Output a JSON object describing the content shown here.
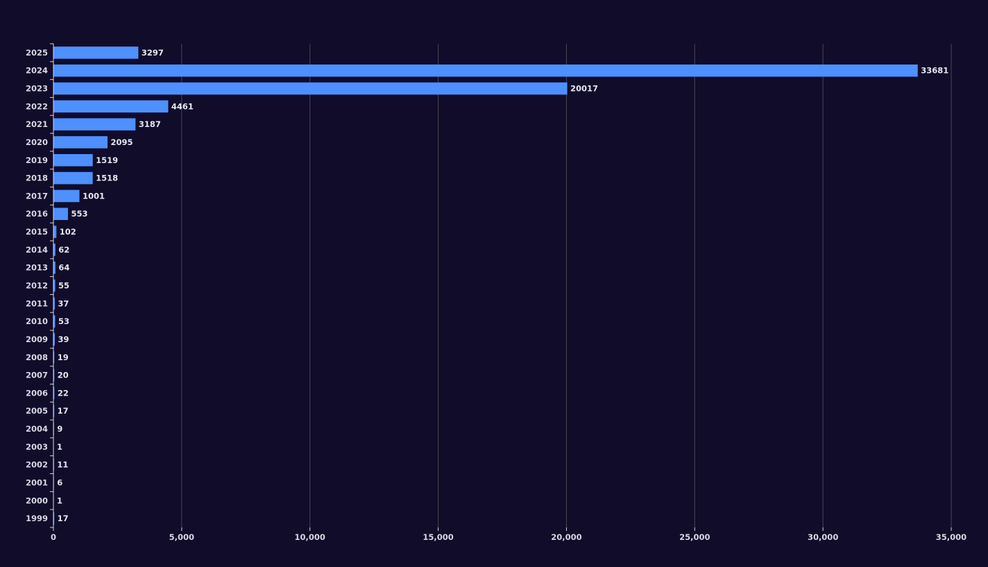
{
  "colors": {
    "background": "#100c2a",
    "bar": "#4d90fe",
    "grid": "#484753",
    "axis": "#d7d7e3",
    "text": "#d7d7e3"
  },
  "chart_data": {
    "type": "bar",
    "orientation": "horizontal",
    "title": "",
    "xlabel": "",
    "ylabel": "",
    "categories": [
      "2025",
      "2024",
      "2023",
      "2022",
      "2021",
      "2020",
      "2019",
      "2018",
      "2017",
      "2016",
      "2015",
      "2014",
      "2013",
      "2012",
      "2011",
      "2010",
      "2009",
      "2008",
      "2007",
      "2006",
      "2005",
      "2004",
      "2003",
      "2002",
      "2001",
      "2000",
      "1999"
    ],
    "values": [
      3297,
      33681,
      20017,
      4461,
      3187,
      2095,
      1519,
      1518,
      1001,
      553,
      102,
      62,
      64,
      55,
      37,
      53,
      39,
      19,
      20,
      22,
      17,
      9,
      1,
      11,
      6,
      1,
      17
    ],
    "xlim": [
      0,
      35000
    ],
    "xticks": [
      0,
      5000,
      10000,
      15000,
      20000,
      25000,
      30000,
      35000
    ],
    "xtick_labels": [
      "0",
      "5,000",
      "10,000",
      "15,000",
      "20,000",
      "25,000",
      "30,000",
      "35,000"
    ],
    "grid": "vertical",
    "legend": "none",
    "data_labels": true
  }
}
